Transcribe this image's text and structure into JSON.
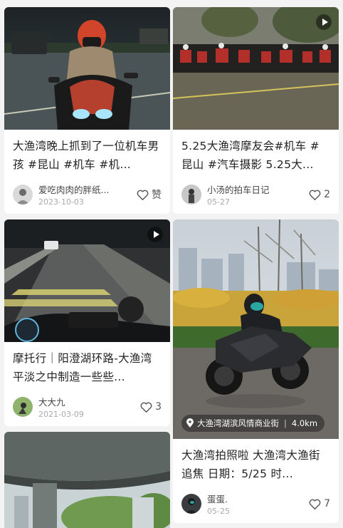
{
  "feed": {
    "left": [
      {
        "title": "大渔湾晚上抓到了一位机车男孩 #昆山 #机车 #机...",
        "author": "爱吃肉肉的胖纸...",
        "date": "2023-10-03",
        "likes": "赞",
        "has_video": false
      },
      {
        "title": "摩托行｜阳澄湖环路-大渔湾 平淡之中制造一些些...",
        "author": "大大九",
        "date": "2021-03-09",
        "likes": "3",
        "has_video": true
      }
    ],
    "right": [
      {
        "title": "5.25大渔湾摩友会#机车 #昆山 #汽车摄影 5.25大...",
        "author": "小汤的拍车日记",
        "date": "05-27",
        "likes": "2",
        "has_video": true
      },
      {
        "title": "大渔湾拍照啦 大渔湾大渔街追焦 日期：5/25 时...",
        "author": "蛋蛋.",
        "date": "05-25",
        "likes": "7",
        "location": "大渔湾湖滨风情商业街",
        "distance": "4.0km",
        "has_video": false
      }
    ]
  },
  "icons": {
    "like": "heart-outline-icon",
    "video": "play-icon",
    "location": "location-pin-icon"
  },
  "colors": {
    "background": "#f3f3f3",
    "card": "#ffffff",
    "title_text": "#222222",
    "meta_text": "#aaaaaa"
  }
}
